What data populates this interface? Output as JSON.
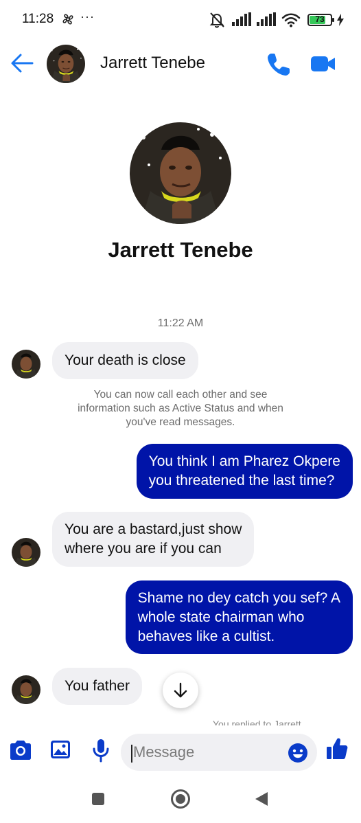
{
  "status_bar": {
    "time": "11:28",
    "more": "···",
    "battery": "73"
  },
  "header": {
    "contact_name": "Jarrett Tenebe",
    "icons": [
      "back-arrow-icon",
      "phone-icon",
      "video-camera-icon"
    ]
  },
  "profile": {
    "name": "Jarrett Tenebe"
  },
  "timestamp": "11:22 AM",
  "messages": [
    {
      "from": "contact",
      "lines": [
        "Your death is close"
      ]
    },
    {
      "from": "me",
      "lines": [
        "You think I am Pharez Okpere",
        "you threatened the last time?"
      ]
    },
    {
      "from": "contact",
      "lines": [
        "You are a bastard,just show",
        "where you are if you can"
      ]
    },
    {
      "from": "me",
      "lines": [
        "Shame no dey catch you sef? A",
        "whole state chairman who",
        "behaves like a cultist."
      ]
    },
    {
      "from": "contact",
      "lines": [
        "You father"
      ]
    }
  ],
  "system_note": {
    "lines": [
      "You can now call each other and see",
      "information such as Active Status and when",
      "you've read messages."
    ]
  },
  "reply_hint": "You replied to Jarrett",
  "composer": {
    "placeholder": "Message",
    "icons": [
      "camera-icon",
      "gallery-icon",
      "microphone-icon",
      "emoji-icon",
      "thumbs-up-icon"
    ]
  },
  "colors": {
    "accent": "#1877f2",
    "outgoing_bubble": "#0014a8",
    "incoming_bubble": "#f0f0f3",
    "composer_icons": "#0a3bc9"
  }
}
